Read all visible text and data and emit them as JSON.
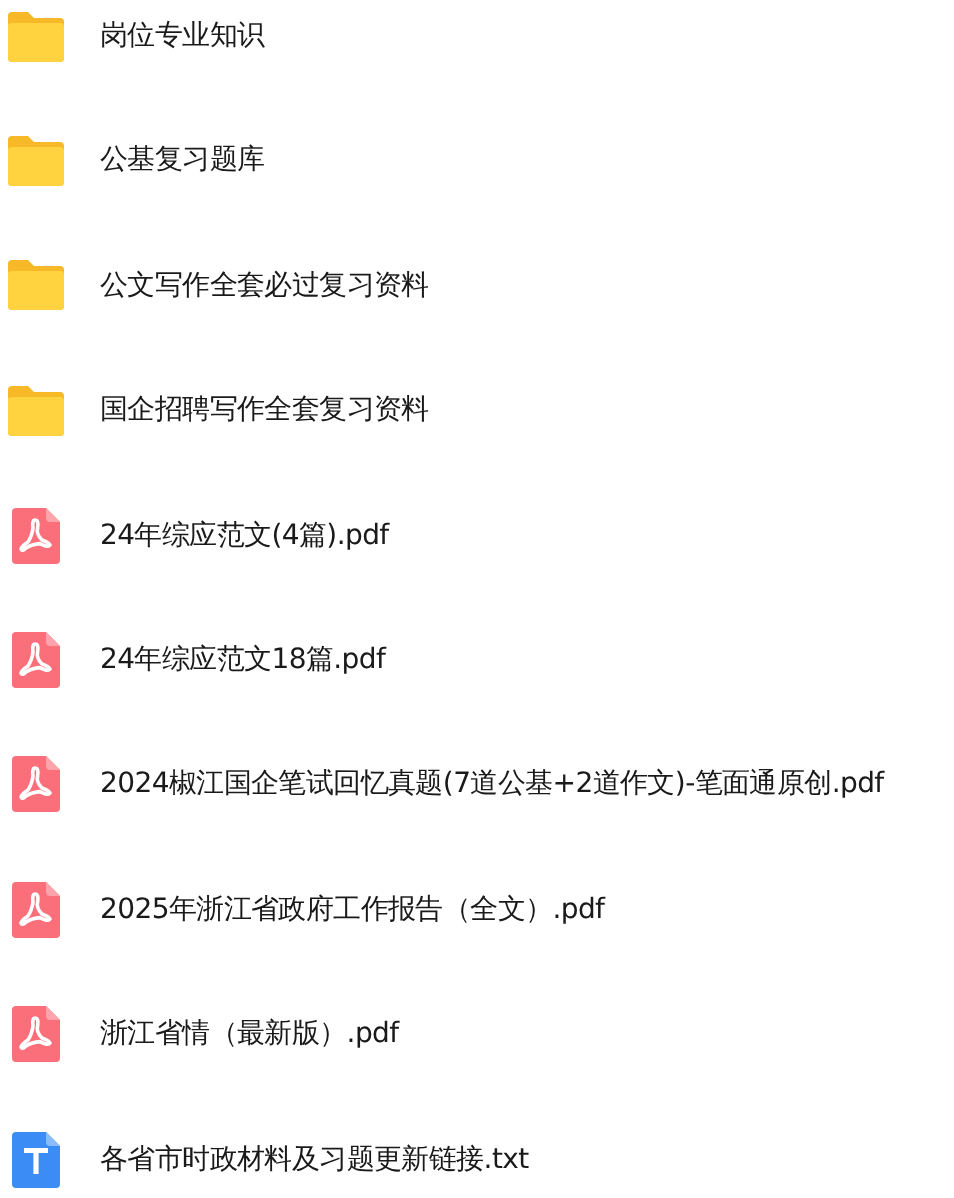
{
  "files": [
    {
      "name": "岗位专业知识",
      "kind": "folder"
    },
    {
      "name": "公基复习题库",
      "kind": "folder"
    },
    {
      "name": "公文写作全套必过复习资料",
      "kind": "folder"
    },
    {
      "name": "国企招聘写作全套复习资料",
      "kind": "folder"
    },
    {
      "name": "24年综应范文(4篇).pdf",
      "kind": "pdf"
    },
    {
      "name": "24年综应范文18篇.pdf",
      "kind": "pdf"
    },
    {
      "name": "2024椒江国企笔试回忆真题(7道公基+2道作文)-笔面通原创.pdf",
      "kind": "pdf"
    },
    {
      "name": "2025年浙江省政府工作报告（全文）.pdf",
      "kind": "pdf"
    },
    {
      "name": "浙江省情（最新版）.pdf",
      "kind": "pdf"
    },
    {
      "name": "各省市时政材料及习题更新链接.txt",
      "kind": "txt"
    }
  ]
}
